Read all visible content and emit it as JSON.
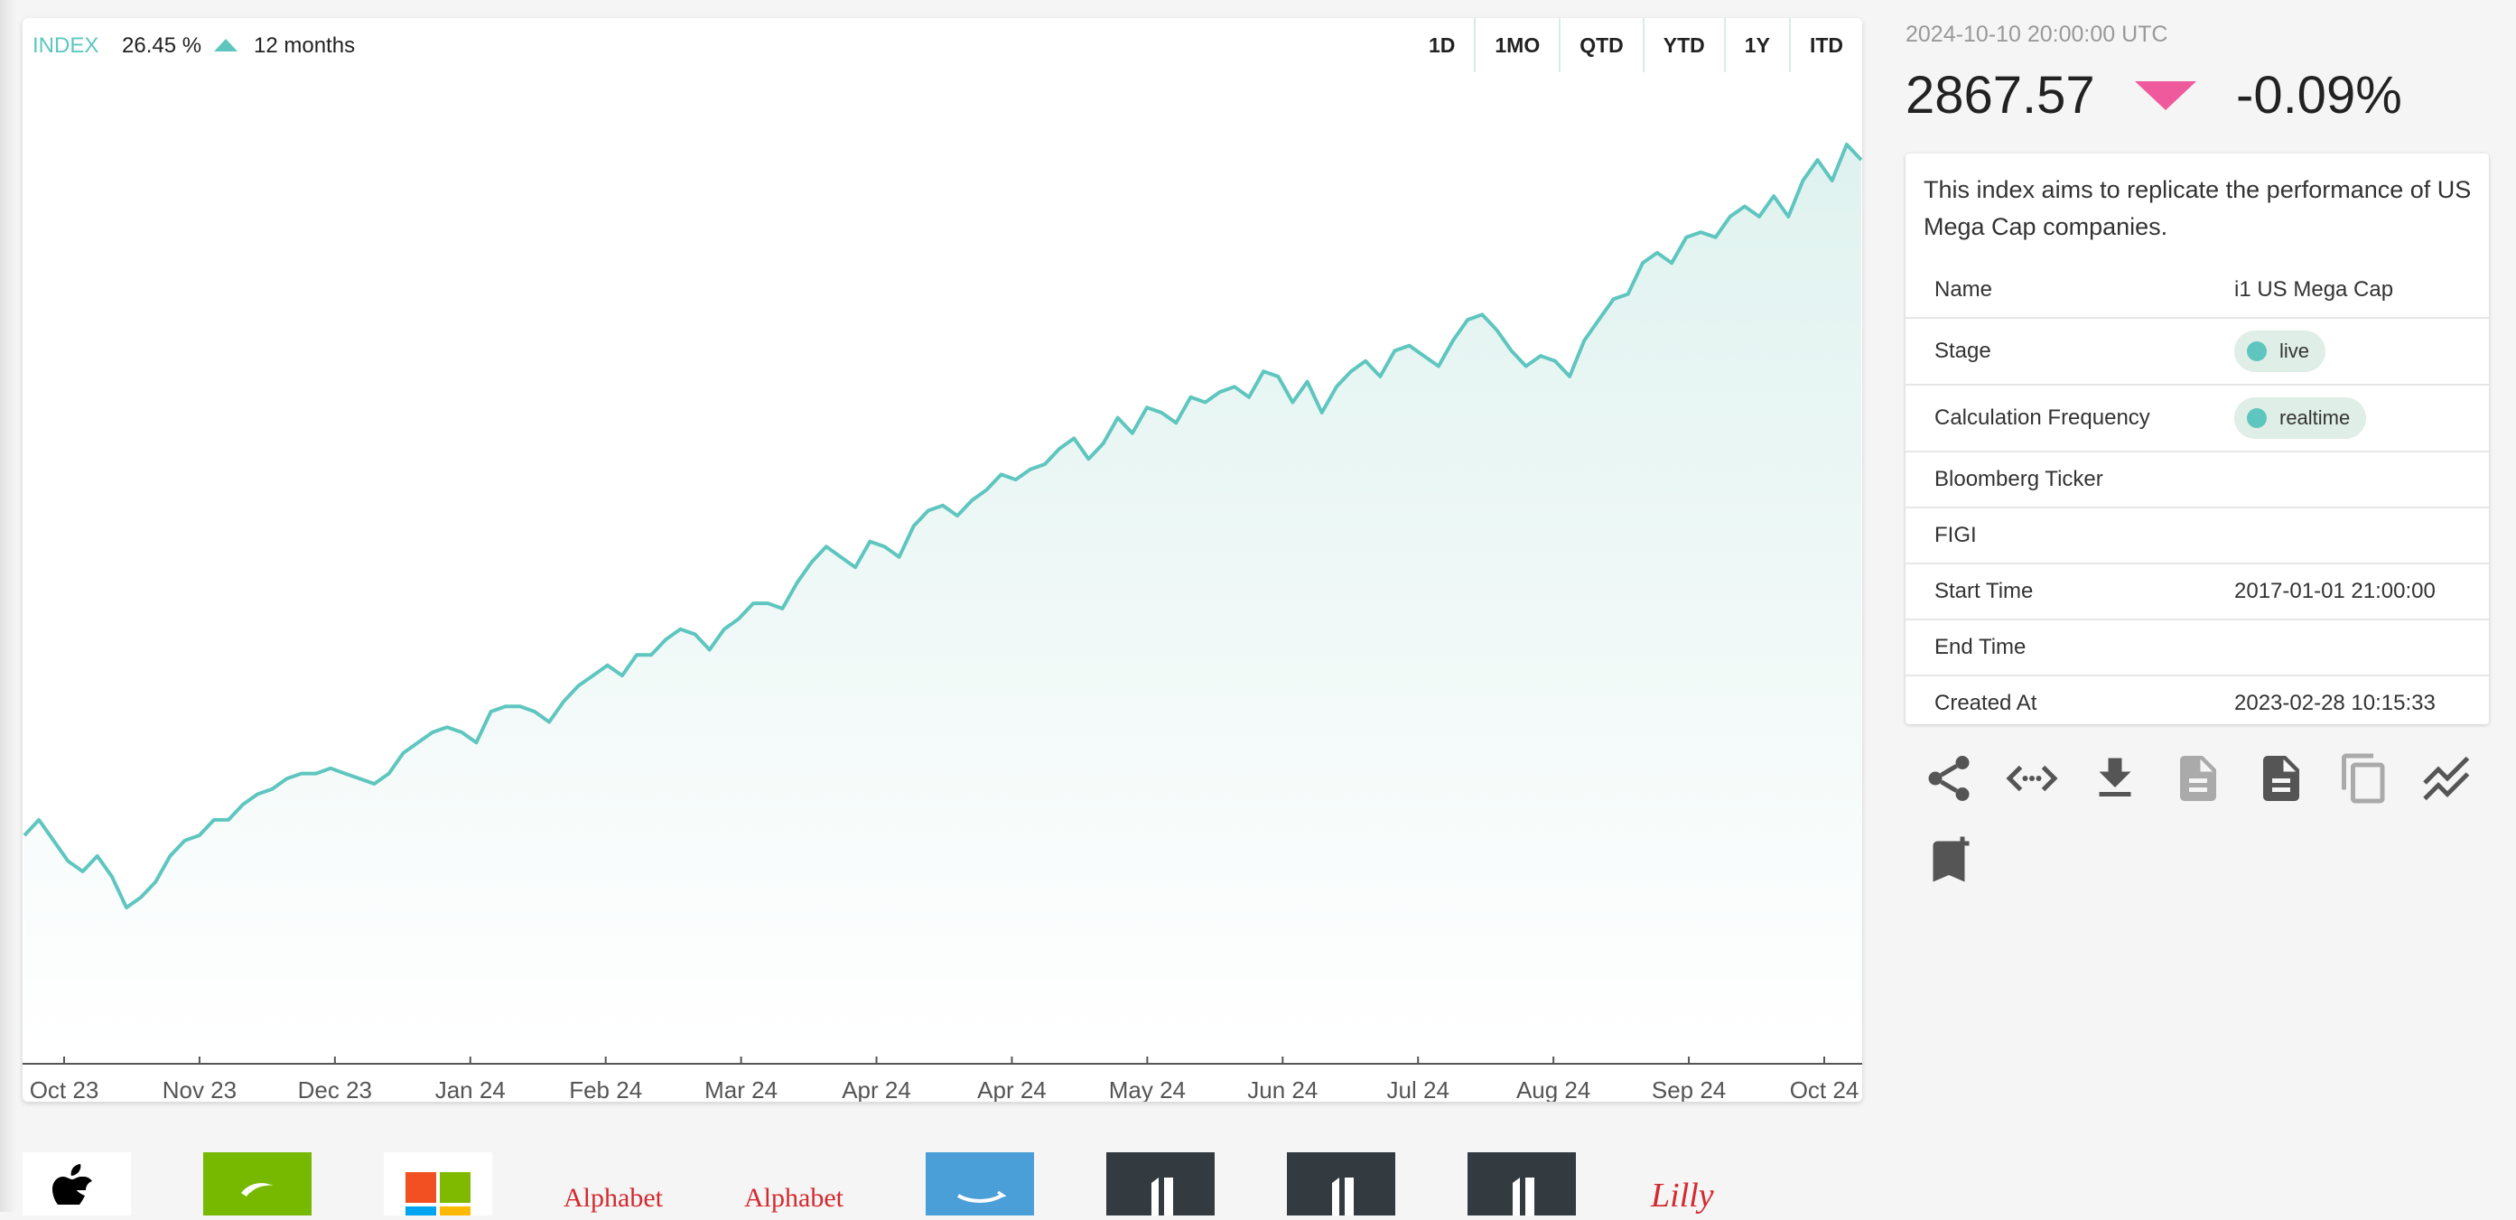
{
  "header": {
    "index_label": "INDEX",
    "return_pct": "26.45 %",
    "period": "12 months",
    "ranges": [
      "1D",
      "1MO",
      "QTD",
      "YTD",
      "1Y",
      "ITD"
    ]
  },
  "quote": {
    "timestamp": "2024-10-10 20:00:00 UTC",
    "price": "2867.57",
    "change": "-0.09%",
    "down_color": "#ee5a9b"
  },
  "info": {
    "description": "This index aims to replicate the performance of US Mega Cap companies.",
    "rows": [
      {
        "key": "Name",
        "value": "i1 US Mega Cap"
      },
      {
        "key": "Stage",
        "chip": "live"
      },
      {
        "key": "Calculation Frequency",
        "chip": "realtime"
      },
      {
        "key": "Bloomberg Ticker",
        "value": ""
      },
      {
        "key": "FIGI",
        "value": ""
      },
      {
        "key": "Start Time",
        "value": "2017-01-01 21:00:00"
      },
      {
        "key": "End Time",
        "value": ""
      },
      {
        "key": "Created At",
        "value": "2023-02-28 10:15:33"
      }
    ]
  },
  "toolbar": [
    "share-icon",
    "code-icon",
    "download-icon",
    "document-icon",
    "document-filled-icon",
    "copy-icon",
    "compare-icon",
    "bookmark-add-icon"
  ],
  "logos": {
    "alphabet_1": "Alphabet",
    "alphabet_2": "Alphabet",
    "lilly": "Lilly"
  },
  "colors": {
    "accent": "#5ec6bf",
    "fill": "#dff2ef"
  },
  "chart_data": {
    "type": "area",
    "x_tick_labels": [
      "Oct 23",
      "Nov 23",
      "Dec 23",
      "Jan 24",
      "Feb 24",
      "Mar 24",
      "Apr 24",
      "Apr 24",
      "May 24",
      "Jun 24",
      "Jul 24",
      "Aug 24",
      "Sep 24",
      "Oct 24"
    ],
    "grid": false,
    "y": [
      100,
      103,
      99,
      95,
      93,
      96,
      92,
      86,
      88,
      91,
      96,
      99,
      100,
      103,
      103,
      106,
      108,
      109,
      111,
      112,
      112,
      113,
      112,
      111,
      110,
      112,
      116,
      118,
      120,
      121,
      120,
      118,
      124,
      125,
      125,
      124,
      122,
      126,
      129,
      131,
      133,
      131,
      135,
      135,
      138,
      140,
      139,
      136,
      140,
      142,
      145,
      145,
      144,
      149,
      153,
      156,
      154,
      152,
      157,
      156,
      154,
      160,
      163,
      164,
      162,
      165,
      167,
      170,
      169,
      171,
      172,
      175,
      177,
      173,
      176,
      181,
      178,
      183,
      182,
      180,
      185,
      184,
      186,
      187,
      185,
      190,
      189,
      184,
      188,
      182,
      187,
      190,
      192,
      189,
      194,
      195,
      193,
      191,
      196,
      200,
      201,
      198,
      194,
      191,
      193,
      192,
      189,
      196,
      200,
      204,
      205,
      211,
      213,
      211,
      216,
      217,
      216,
      220,
      222,
      220,
      224,
      220,
      227,
      231,
      227,
      234,
      231
    ],
    "note_y": "index level, visually estimated relative path"
  }
}
